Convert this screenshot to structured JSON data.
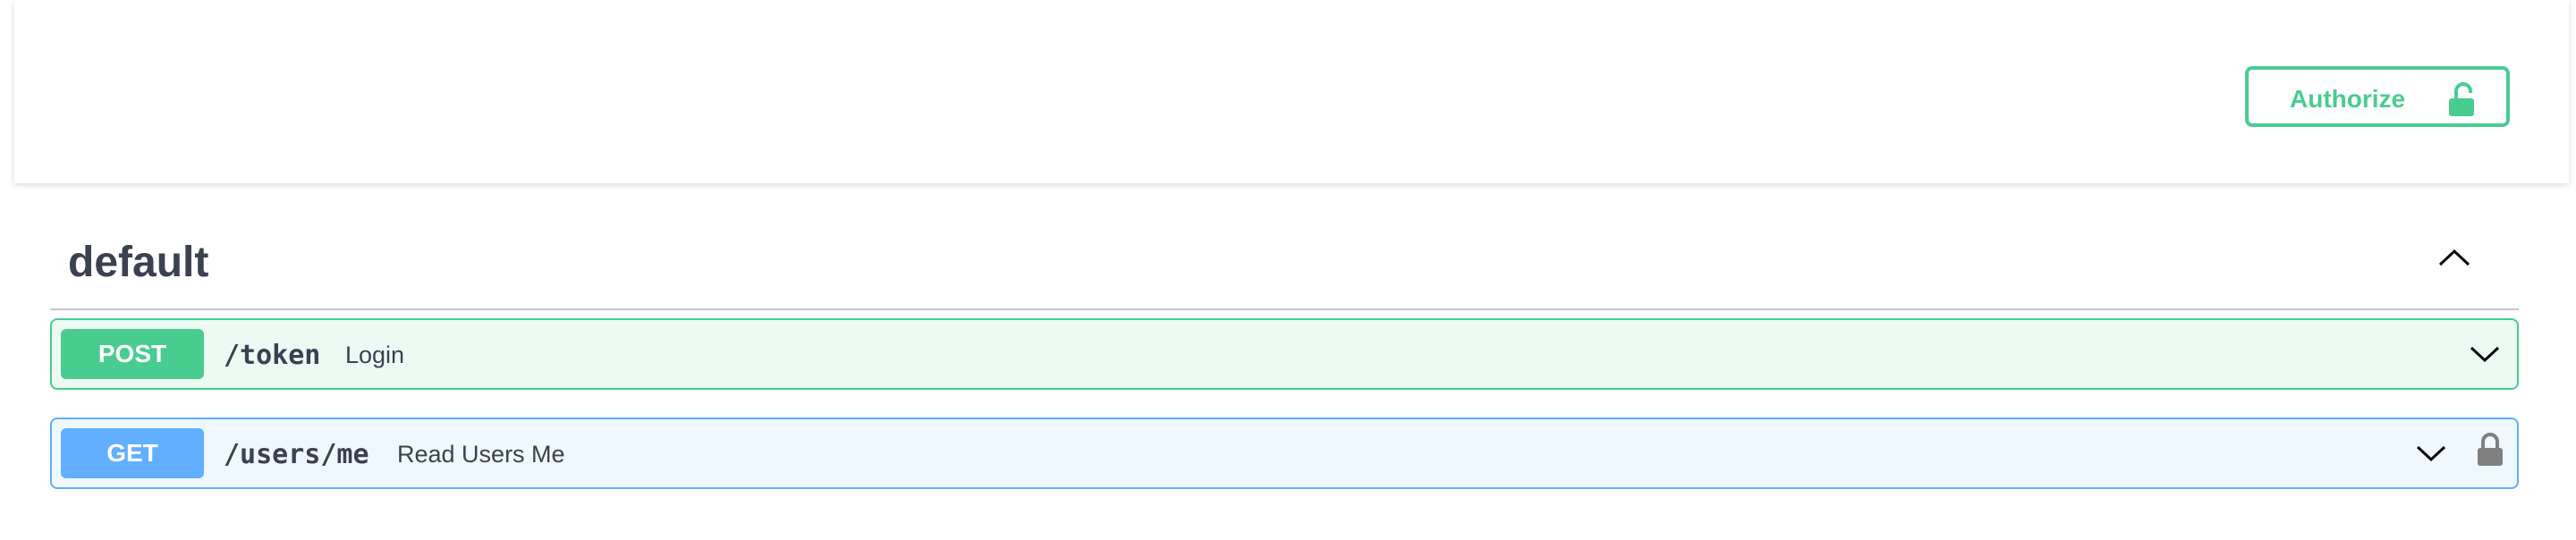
{
  "header": {
    "authorize_label": "Authorize",
    "authorize_icon": "unlocked-padlock-icon"
  },
  "tag": {
    "name": "default",
    "toggle_icon": "chevron-up-icon"
  },
  "operations": [
    {
      "method": "POST",
      "path": "/token",
      "summary": "Login",
      "color": "#49cc90",
      "expand_icon": "chevron-down-icon"
    },
    {
      "method": "GET",
      "path": "/users/me",
      "summary": "Read Users Me",
      "color": "#61affe",
      "expand_icon": "chevron-down-icon",
      "auth_icon": "padlock-icon"
    }
  ],
  "colors": {
    "post": "#49cc90",
    "get": "#61affe",
    "text": "#3b4151"
  }
}
